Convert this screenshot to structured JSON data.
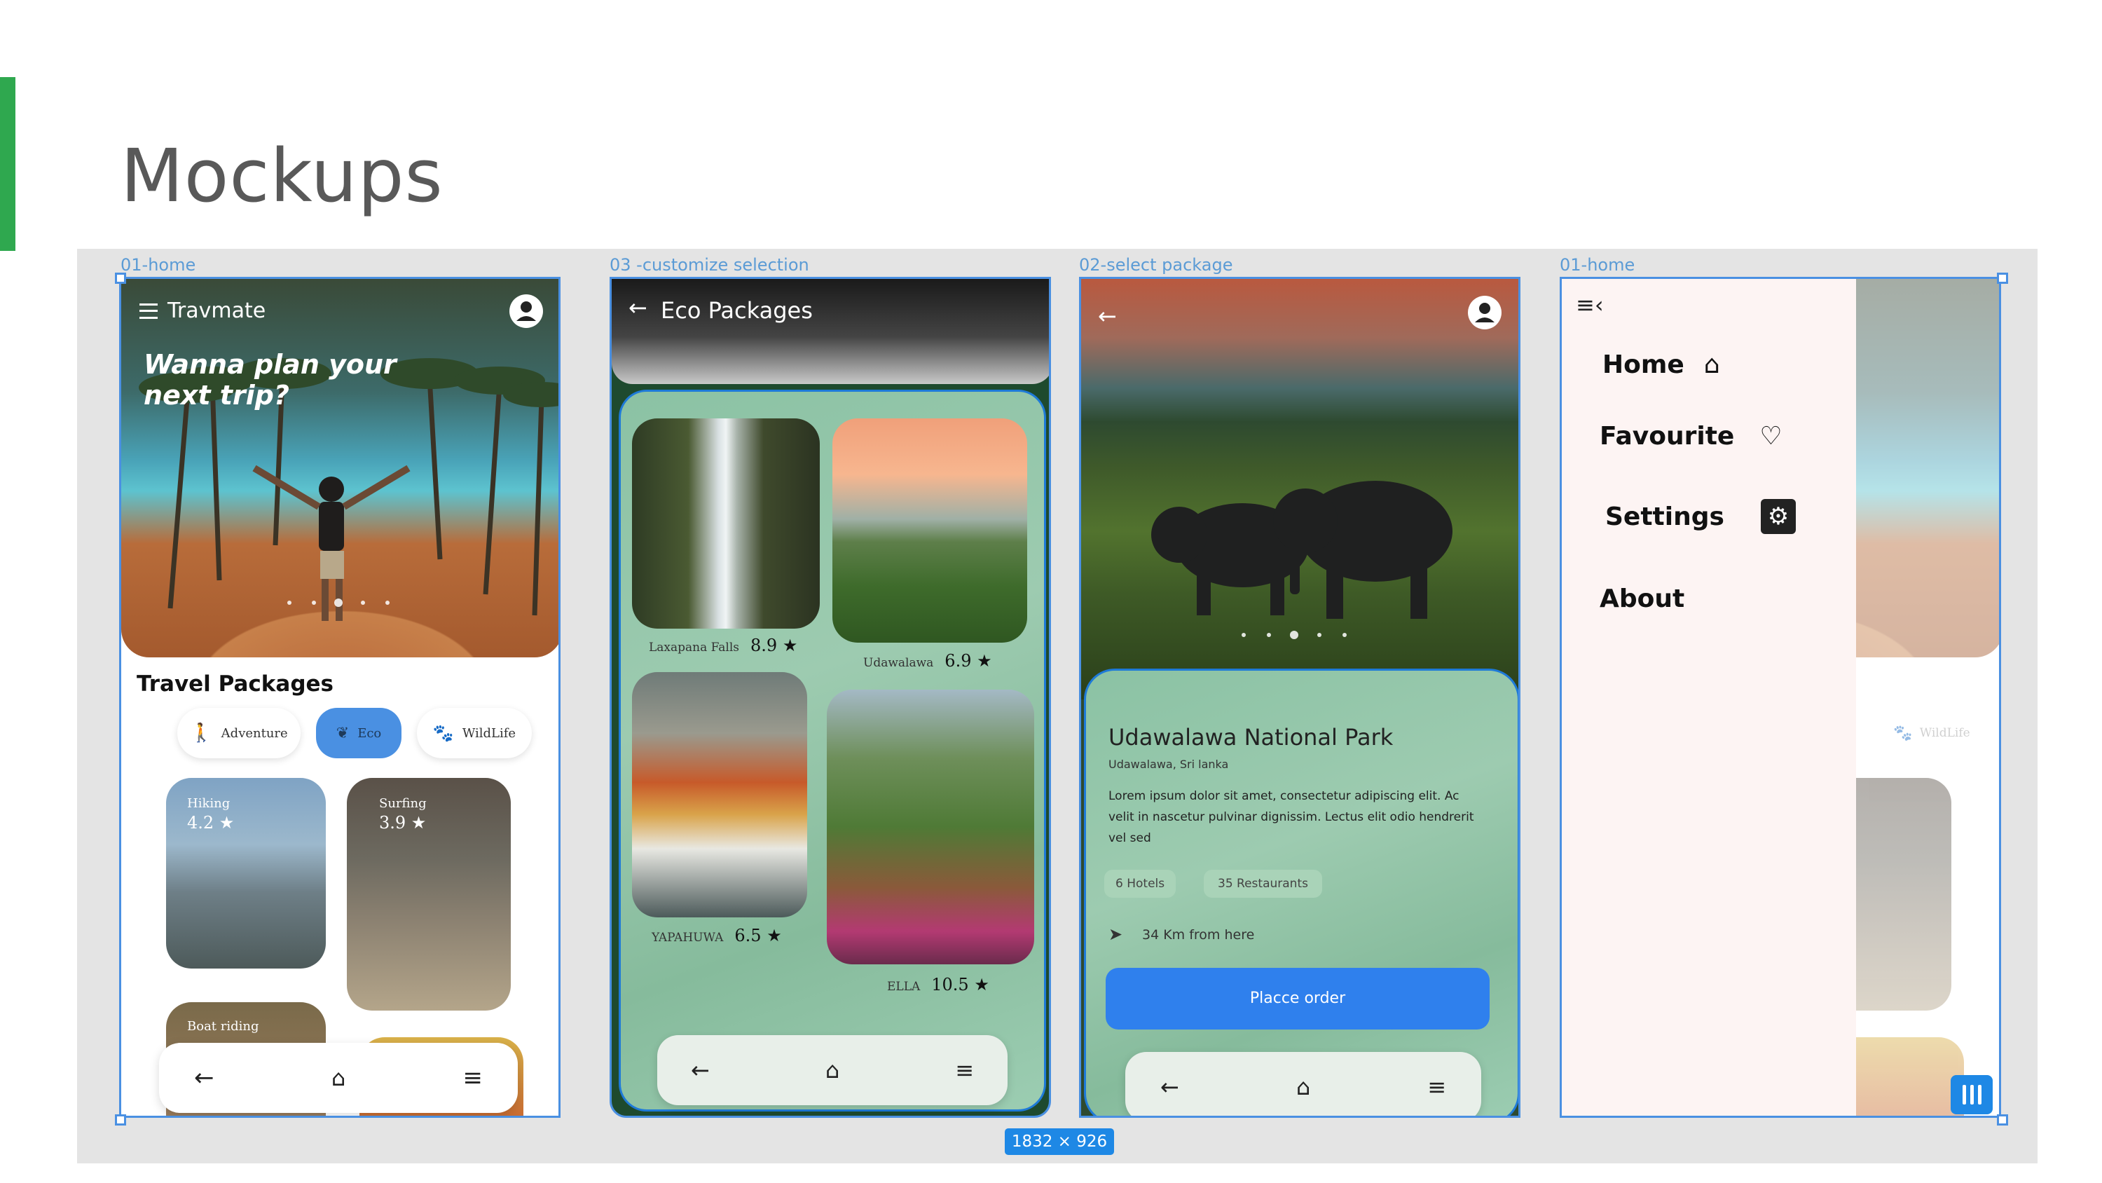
{
  "slide": {
    "title": "Mockups",
    "accent_color": "#2fa84f"
  },
  "canvas": {
    "frame_labels": [
      "01-home",
      "03 -customize selection",
      "02-select package",
      "01-home"
    ],
    "dimensions_badge": "1832 × 926",
    "selection_color": "#4a90e2"
  },
  "home": {
    "app_name": "Travmate",
    "hero_text": "Wanna plan your next trip?",
    "section_title": "Travel Packages",
    "chips": [
      {
        "label": "Adventure",
        "icon": "person-icon",
        "active": false
      },
      {
        "label": "Eco",
        "icon": "leaf-icon",
        "active": true
      },
      {
        "label": "WildLife",
        "icon": "paw-icon",
        "active": false
      }
    ],
    "cards": [
      {
        "name": "Hiking",
        "rating": "4.2 ★"
      },
      {
        "name": "Surfing",
        "rating": "3.9 ★"
      },
      {
        "name": "Boat riding",
        "rating": ""
      }
    ],
    "nav_icons": [
      "back-arrow-icon",
      "home-icon",
      "menu-icon"
    ]
  },
  "eco": {
    "title": "Eco Packages",
    "packages": [
      {
        "name": "Laxapana Falls",
        "rating": "8.9 ★"
      },
      {
        "name": "Udawalawa",
        "rating": "6.9 ★"
      },
      {
        "name": "YAPAHUWA",
        "rating": "6.5 ★"
      },
      {
        "name": "ELLA",
        "rating": "10.5 ★"
      }
    ]
  },
  "detail": {
    "park_name": "Udawalawa National Park",
    "location": "Udawalawa, Sri lanka",
    "description": "Lorem ipsum dolor sit amet, consectetur adipiscing elit. Ac velit in nascetur pulvinar dignissim. Lectus elit odio hendrerit vel sed",
    "tags": [
      "6 Hotels",
      "35 Restaurants"
    ],
    "distance": "34 Km from here",
    "order_button": "Placce order",
    "button_color": "#2f80ed"
  },
  "menu": {
    "items": [
      {
        "label": "Home",
        "icon": "home-icon"
      },
      {
        "label": "Favourite",
        "icon": "heart-icon"
      },
      {
        "label": "Settings",
        "icon": "gear-icon"
      },
      {
        "label": "About",
        "icon": ""
      }
    ],
    "behind_chip": "WildLife"
  }
}
